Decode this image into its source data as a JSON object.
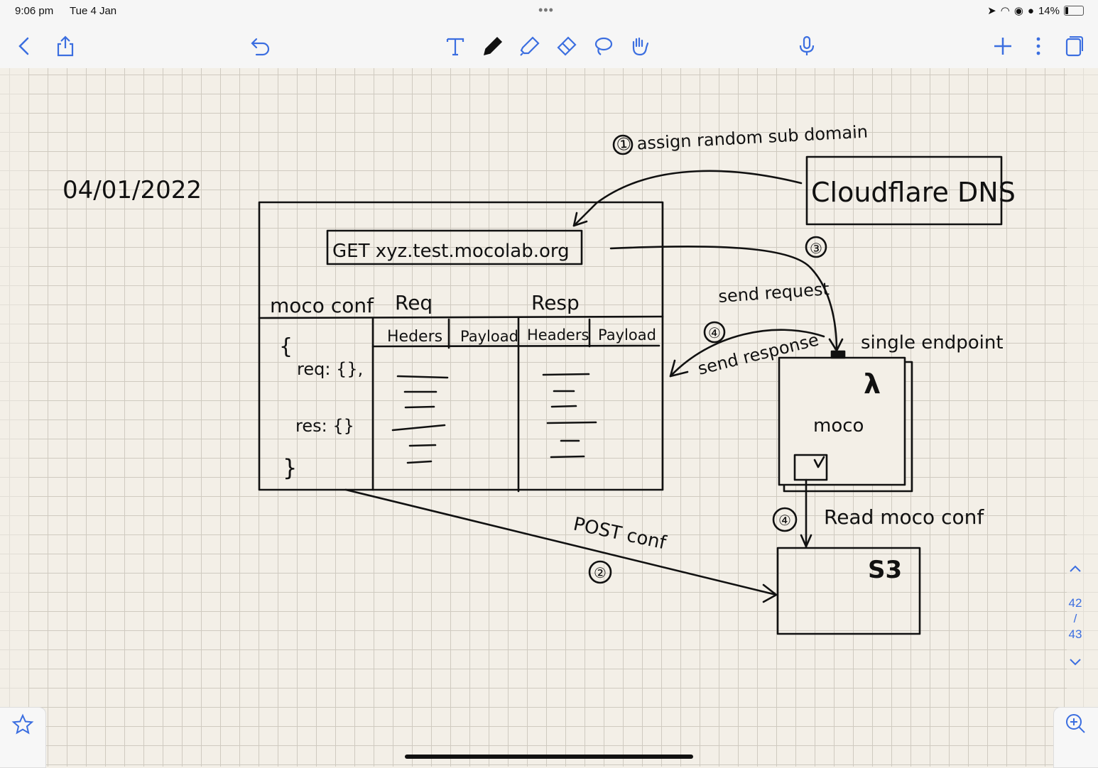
{
  "status": {
    "time": "9:06 pm",
    "date": "Tue 4 Jan",
    "battery": "14%",
    "battery_level": 0.14
  },
  "toolbar": {
    "left": [
      "back-icon",
      "share-icon",
      "undo-icon"
    ],
    "tools": [
      "text-tool-icon",
      "pen-icon",
      "highlighter-icon",
      "eraser-icon",
      "lasso-icon",
      "hand-tool-icon"
    ],
    "right": [
      "microphone-icon",
      "add-page-icon",
      "more-icon",
      "pages-icon"
    ]
  },
  "note": {
    "date": "04/01/2022",
    "labels": {
      "step1": "① assign random sub domain",
      "dns": "Cloudflare DNS",
      "get": "GET xyz.test.mocolab.org",
      "step3": "③",
      "send_request": "send request",
      "moco_conf": "moco conf",
      "req": "Req",
      "resp": "Resp",
      "headers1": "Heders",
      "payload1": "Payload",
      "headers2": "Headers",
      "payload2": "Payload",
      "brace_open": "{",
      "req_line": "req: {},",
      "res_line": "res: {}",
      "brace_close": "}",
      "step4a": "④",
      "send_response": "send response",
      "single_endpoint": "single endpoint",
      "lambda": "λ",
      "moco": "moco",
      "step4b": "④",
      "read_conf": "Read moco conf",
      "s3": "S3",
      "post_conf": "POST conf",
      "step2": "②"
    }
  },
  "pages": {
    "current": "42",
    "separator": "/",
    "total": "43"
  },
  "colors": {
    "ink": "#111111",
    "grid": "#cfcac0",
    "paper": "#f3efe7",
    "accent": "#3b6ee0"
  }
}
